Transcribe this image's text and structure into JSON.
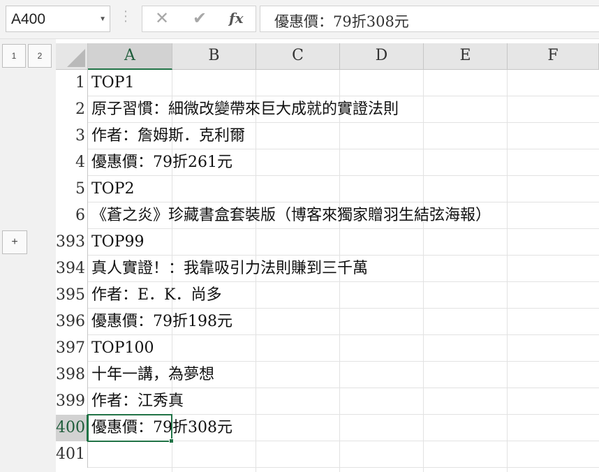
{
  "formula_bar": {
    "name_box": "A400",
    "formula": "優惠價：79折308元",
    "icons": [
      "cancel-icon",
      "enter-icon",
      "insert-function-icon"
    ]
  },
  "outline": {
    "levels": [
      "1",
      "2"
    ],
    "expand_label": "+"
  },
  "columns": [
    "A",
    "B",
    "C",
    "D",
    "E",
    "F"
  ],
  "rows": [
    {
      "num": "1",
      "a": "TOP1"
    },
    {
      "num": "2",
      "a": "原子習慣：細微改變帶來巨大成就的實證法則"
    },
    {
      "num": "3",
      "a": "作者：詹姆斯．克利爾"
    },
    {
      "num": "4",
      "a": "優惠價：79折261元"
    },
    {
      "num": "5",
      "a": "TOP2"
    },
    {
      "num": "6",
      "a": "《蒼之炎》珍藏書盒套裝版（博客來獨家贈羽生結弦海報）"
    },
    {
      "num": "393",
      "a": "TOP99"
    },
    {
      "num": "394",
      "a": "真人實證！：我靠吸引力法則賺到三千萬"
    },
    {
      "num": "395",
      "a": "作者：E．K．尚多"
    },
    {
      "num": "396",
      "a": "優惠價：79折198元"
    },
    {
      "num": "397",
      "a": "TOP100"
    },
    {
      "num": "398",
      "a": "十年一講，為夢想"
    },
    {
      "num": "399",
      "a": "作者：江秀真"
    },
    {
      "num": "400",
      "a": "優惠價：79折308元"
    },
    {
      "num": "401",
      "a": ""
    }
  ],
  "selection": {
    "column": "A",
    "row": "400"
  },
  "colors": {
    "accent": "#217346",
    "header_bg": "#e6e6e6",
    "active_header_bg": "#d2d2d2"
  }
}
